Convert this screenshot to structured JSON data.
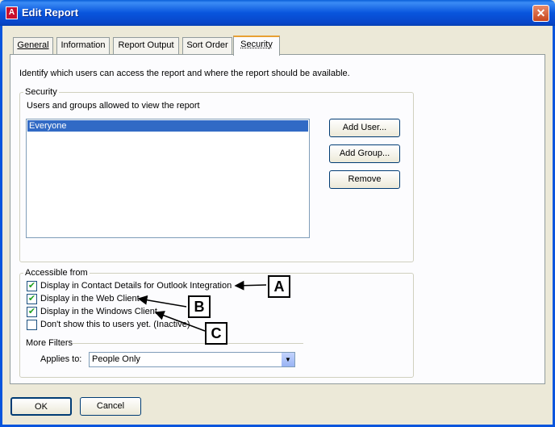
{
  "window": {
    "title": "Edit Report",
    "icon_letter": "A",
    "close_glyph": "✕"
  },
  "tabs": [
    {
      "label": "General"
    },
    {
      "label": "Information"
    },
    {
      "label": "Report Output"
    },
    {
      "label": "Sort Order"
    },
    {
      "label": "Security"
    }
  ],
  "active_tab": "Security",
  "description": "Identify which users can access the report and where the report should be available.",
  "security": {
    "legend": "Security",
    "subtitle": "Users and groups allowed to view the report",
    "list_items": [
      "Everyone"
    ],
    "buttons": {
      "add_user": "Add User...",
      "add_group": "Add Group...",
      "remove": "Remove"
    }
  },
  "accessible": {
    "legend": "Accessible from",
    "options": [
      {
        "label": "Display in Contact Details for Outlook Integration",
        "checked": true
      },
      {
        "label": "Display in the Web Client",
        "checked": true
      },
      {
        "label": "Display in the Windows Client",
        "checked": true
      },
      {
        "label": "Don't show this to users yet. (Inactive)",
        "checked": false
      }
    ],
    "check_glyph": "✔"
  },
  "filters": {
    "legend": "More Filters",
    "applies_label": "Applies to:",
    "applies_value": "People Only"
  },
  "callouts": [
    "A",
    "B",
    "C"
  ],
  "footer": {
    "ok": "OK",
    "cancel": "Cancel"
  }
}
